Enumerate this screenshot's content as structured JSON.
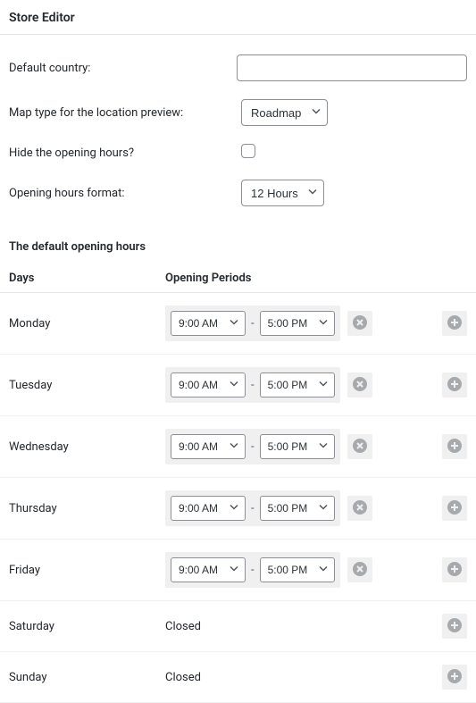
{
  "section": {
    "title": "Store Editor"
  },
  "fields": {
    "default_country": {
      "label": "Default country:",
      "value": ""
    },
    "map_type": {
      "label": "Map type for the location preview:",
      "value": "Roadmap"
    },
    "hide_hours": {
      "label": "Hide the opening hours?"
    },
    "hours_format": {
      "label": "Opening hours format:",
      "value": "12 Hours"
    }
  },
  "hours_section": {
    "title": "The default opening hours",
    "col_days": "Days",
    "col_periods": "Opening Periods",
    "dash": "-",
    "closed_label": "Closed"
  },
  "days": [
    {
      "name": "Monday",
      "open": "9:00 AM",
      "close": "5:00 PM",
      "closed": false
    },
    {
      "name": "Tuesday",
      "open": "9:00 AM",
      "close": "5:00 PM",
      "closed": false
    },
    {
      "name": "Wednesday",
      "open": "9:00 AM",
      "close": "5:00 PM",
      "closed": false
    },
    {
      "name": "Thursday",
      "open": "9:00 AM",
      "close": "5:00 PM",
      "closed": false
    },
    {
      "name": "Friday",
      "open": "9:00 AM",
      "close": "5:00 PM",
      "closed": false
    },
    {
      "name": "Saturday",
      "closed": true
    },
    {
      "name": "Sunday",
      "closed": true
    }
  ]
}
